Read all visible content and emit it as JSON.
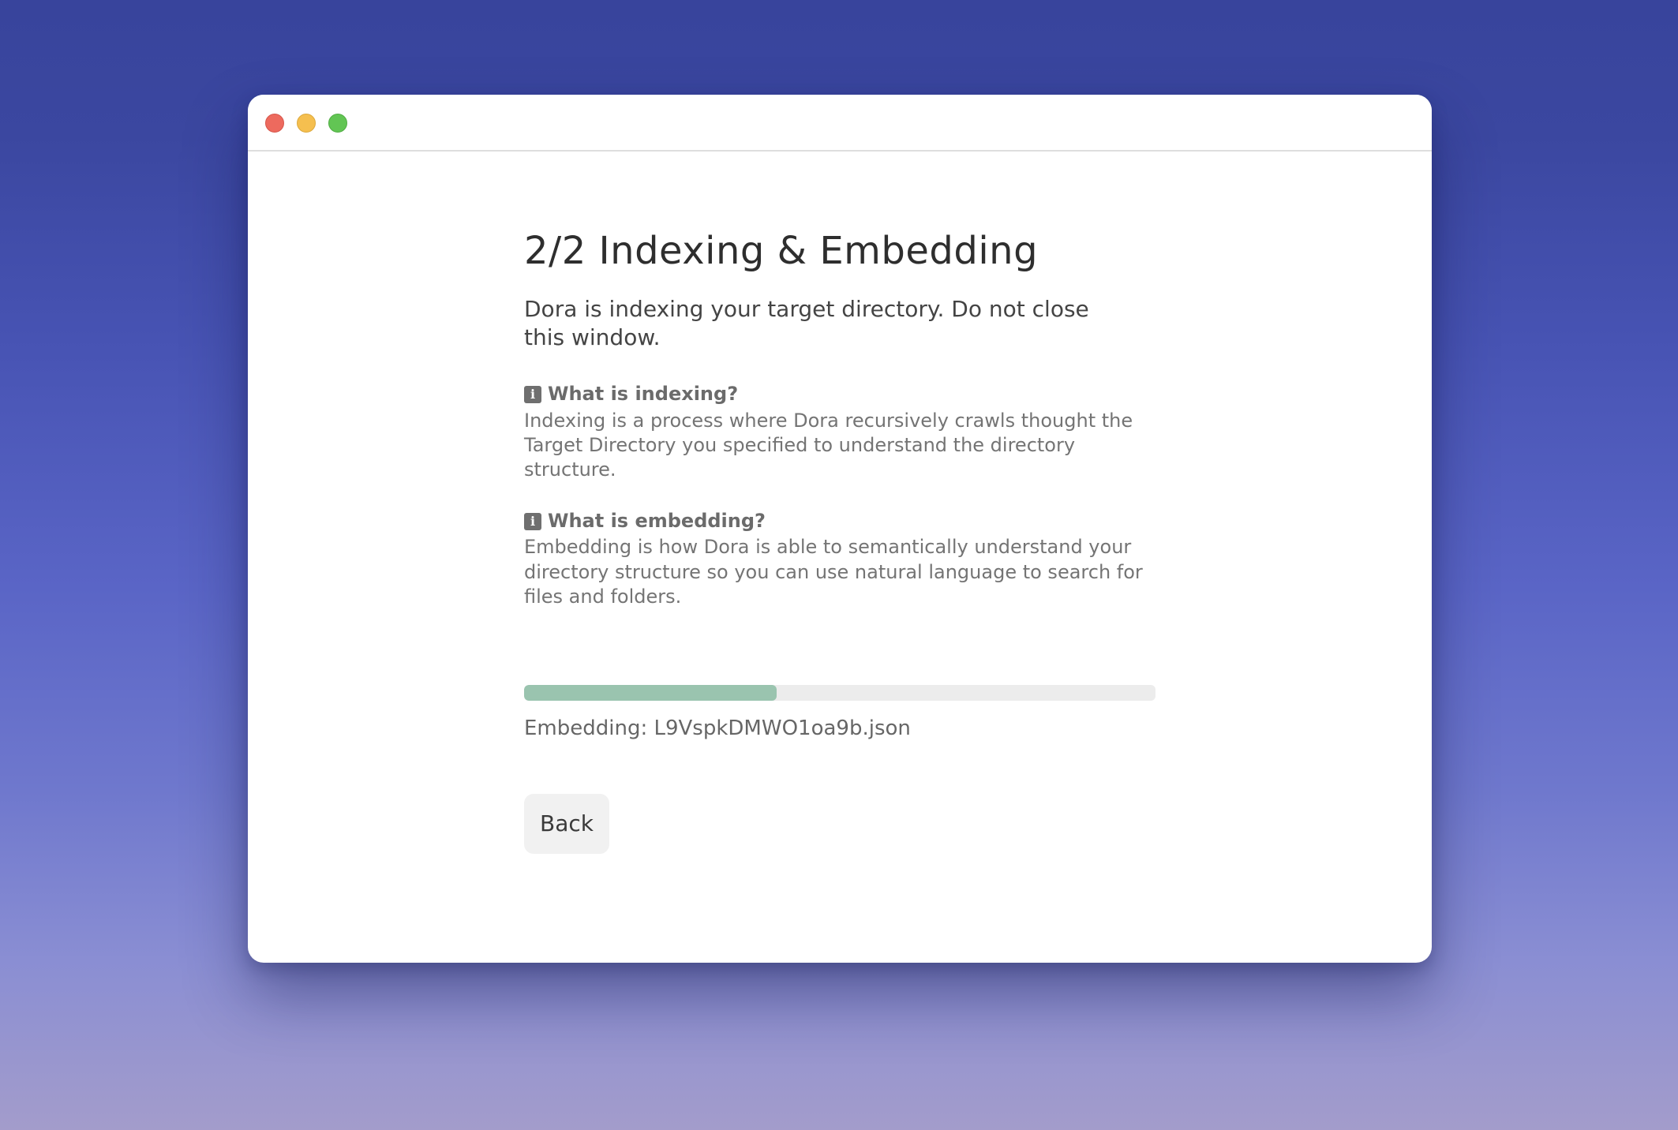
{
  "window": {
    "controls": {
      "close": "close-button",
      "minimize": "minimize-button",
      "maximize": "maximize-button"
    }
  },
  "page": {
    "title": "2/2 Indexing & Embedding",
    "subtitle": "Dora is indexing your target directory. Do not close this window.",
    "faq": [
      {
        "icon": "info-icon",
        "question": "What is indexing?",
        "answer": "Indexing is a process where Dora recursively crawls thought the Target Directory you specified to understand the directory structure."
      },
      {
        "icon": "info-icon",
        "question": "What is embedding?",
        "answer": "Embedding is how Dora is able to semantically understand your directory structure so you can use natural language to search for files and folders."
      }
    ],
    "progress": {
      "fraction": 0.4,
      "status": "Embedding: L9VspkDMWO1oa9b.json"
    },
    "back_label": "Back"
  },
  "colors": {
    "background_top": "#38449c",
    "background_bottom": "#a39ccb",
    "progress_fill": "#9ac4af",
    "progress_track": "#ececec",
    "button_bg": "#f1f1f1"
  }
}
